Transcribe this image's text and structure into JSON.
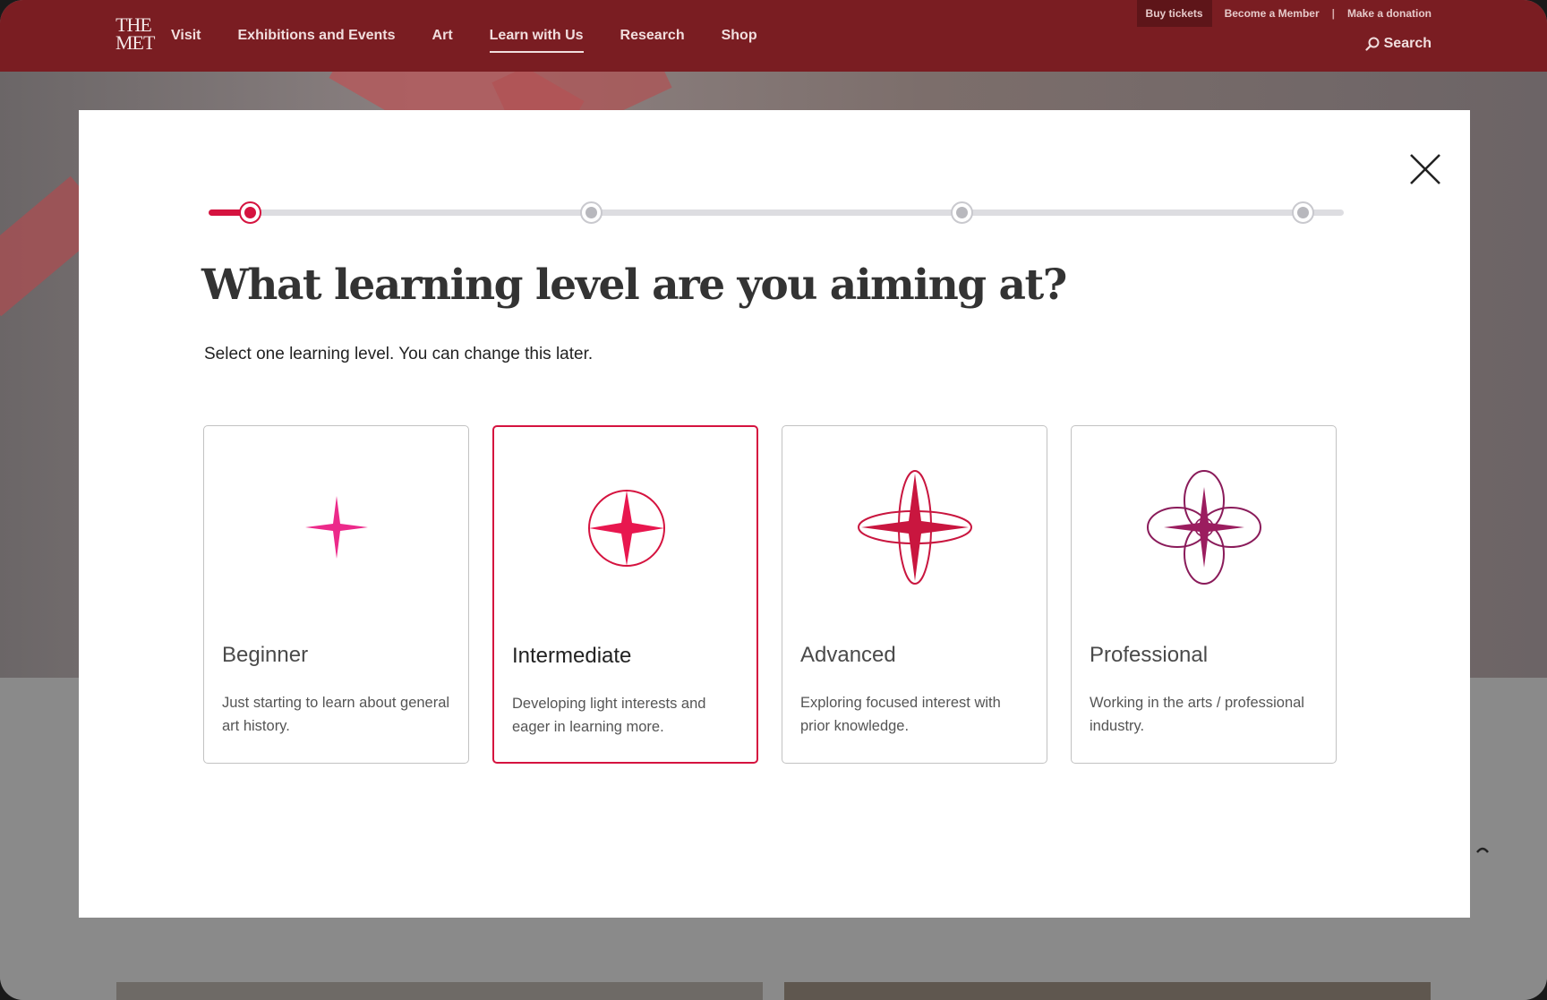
{
  "header": {
    "logo_line1": "THE",
    "logo_line2": "MET",
    "nav": [
      {
        "label": "Visit",
        "active": false
      },
      {
        "label": "Exhibitions and Events",
        "active": false
      },
      {
        "label": "Art",
        "active": false
      },
      {
        "label": "Learn with Us",
        "active": true
      },
      {
        "label": "Research",
        "active": false
      },
      {
        "label": "Shop",
        "active": false
      }
    ],
    "utility": {
      "buy_tickets": "Buy tickets",
      "become_member": "Become a Member",
      "separator": "|",
      "donation": "Make a donation"
    },
    "search_label": "Search"
  },
  "modal": {
    "title": "What learning level are you aiming at?",
    "subtitle": "Select one learning level. You can change this later.",
    "progress": {
      "steps": 4,
      "current_step": 1
    },
    "levels": [
      {
        "name": "Beginner",
        "description": "Just starting to learn about general art history.",
        "selected": false,
        "icon": "four-point-star-icon"
      },
      {
        "name": "Intermediate",
        "description": "Developing light interests and eager in learning more.",
        "selected": true,
        "icon": "star-in-circle-icon"
      },
      {
        "name": "Advanced",
        "description": "Exploring focused interest with prior knowledge.",
        "selected": false,
        "icon": "star-with-orbits-icon"
      },
      {
        "name": "Professional",
        "description": "Working in the arts / professional industry.",
        "selected": false,
        "icon": "flower-star-icon"
      }
    ]
  },
  "colors": {
    "header_bg": "#7a1d22",
    "accent": "#d5133f",
    "beginner_pink": "#ec2a8a",
    "professional_purple": "#8a1b5a"
  }
}
